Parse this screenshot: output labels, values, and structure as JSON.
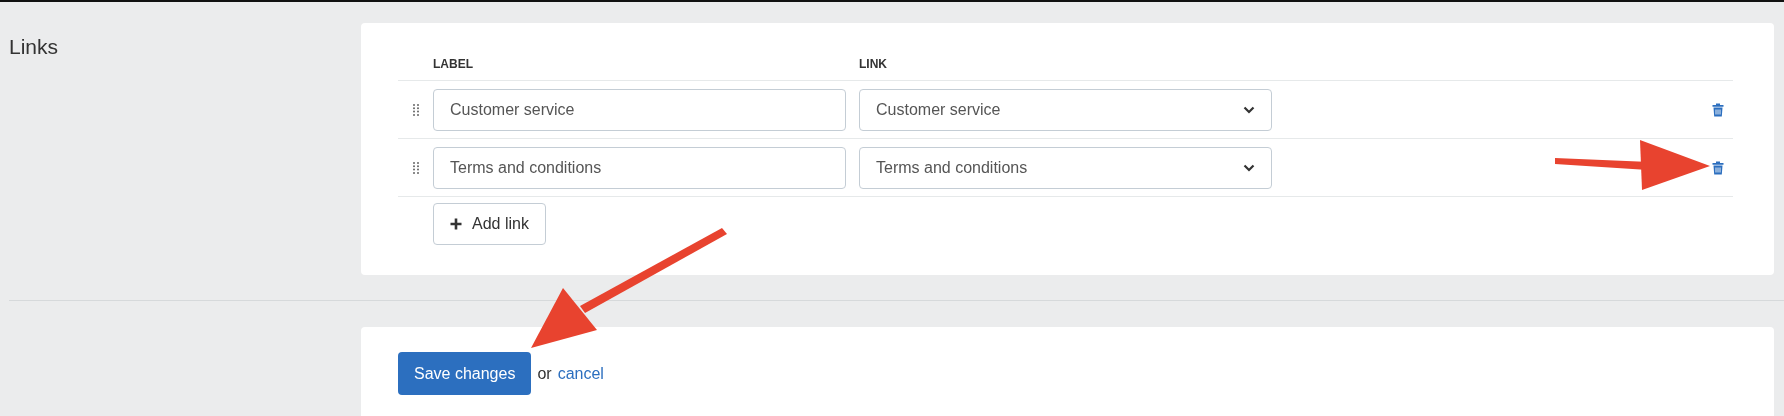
{
  "section": {
    "title": "Links"
  },
  "table": {
    "columns": [
      "LABEL",
      "LINK"
    ],
    "rows": [
      {
        "label": "Customer service",
        "link": "Customer service"
      },
      {
        "label": "Terms and conditions",
        "link": "Terms and conditions"
      }
    ]
  },
  "add_button": {
    "label": "Add link"
  },
  "footer": {
    "save_button": "Save changes",
    "separator": "or",
    "cancel_link": "cancel"
  }
}
